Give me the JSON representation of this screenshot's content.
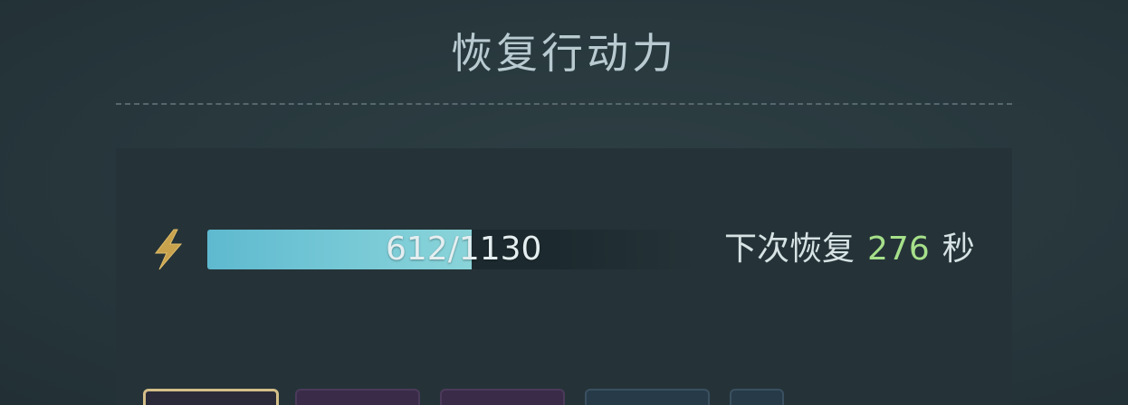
{
  "dialog": {
    "title": "恢复行动力"
  },
  "stamina": {
    "icon": "lightning-bolt-icon",
    "current": 612,
    "max": 1130,
    "text": "612/1130",
    "fill_fraction": 0.5416,
    "next_recover_label": "下次恢复",
    "next_recover_seconds": "276",
    "seconds_unit": "秒"
  },
  "colors": {
    "bar_fill": "#77c9d6",
    "countdown": "#a6e08a",
    "selected_slot_border": "#d4be88"
  },
  "item_slots": [
    {
      "id": "slot-1",
      "selected": true
    },
    {
      "id": "slot-2",
      "selected": false
    },
    {
      "id": "slot-3",
      "selected": false
    },
    {
      "id": "slot-4",
      "selected": false
    },
    {
      "id": "slot-5",
      "selected": false
    }
  ]
}
